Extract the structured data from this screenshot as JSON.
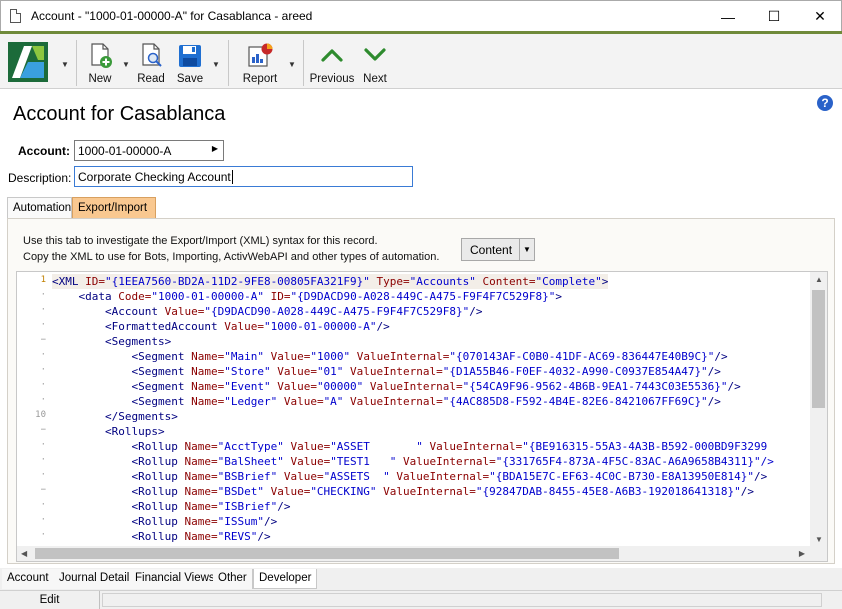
{
  "window": {
    "title": "Account - \"1000-01-00000-A\" for Casablanca - areed",
    "controls": {
      "minimize": "—",
      "maximize": "☐",
      "close": "✕"
    }
  },
  "toolbar": {
    "new_label": "New",
    "read_label": "Read",
    "save_label": "Save",
    "report_label": "Report",
    "previous_label": "Previous",
    "next_label": "Next"
  },
  "header": {
    "title": "Account for Casablanca"
  },
  "form": {
    "account_label": "Account:",
    "account_value": "1000-01-00000-A",
    "description_label": "Description:",
    "description_value": "Corporate Checking Account"
  },
  "top_tabs": [
    {
      "label": "Automation",
      "active": false
    },
    {
      "label": "Export/Import",
      "active": true
    }
  ],
  "panel": {
    "info_line1": "Use this tab to investigate the Export/Import (XML) syntax for this record.",
    "info_line2": "Copy the XML to use for Bots, Importing, ActivWebAPI and other types of automation.",
    "content_select": "Content"
  },
  "gutter": [
    "1",
    "·",
    "·",
    "·",
    "−",
    "·",
    "·",
    "·",
    "·",
    "10",
    "−",
    "·",
    "·",
    "·",
    "−",
    "·",
    "·",
    "·"
  ],
  "xml_lines": [
    [
      [
        "tag",
        "<XML "
      ],
      [
        "attr",
        "ID="
      ],
      [
        "val",
        "\"{1EEA7560-BD2A-11D2-9FE8-00805FA321F9}\""
      ],
      [
        "attr",
        " Type="
      ],
      [
        "val",
        "\"Accounts\""
      ],
      [
        "attr",
        " Content="
      ],
      [
        "val",
        "\"Complete\""
      ],
      [
        "tag",
        ">"
      ]
    ],
    [
      [
        "sp",
        "    "
      ],
      [
        "tag",
        "<data "
      ],
      [
        "attr",
        "Code="
      ],
      [
        "val",
        "\"1000-01-00000-A\""
      ],
      [
        "attr",
        " ID="
      ],
      [
        "val",
        "\"{D9DACD90-A028-449C-A475-F9F4F7C529F8}\""
      ],
      [
        "tag",
        ">"
      ]
    ],
    [
      [
        "sp",
        "        "
      ],
      [
        "tag",
        "<Account "
      ],
      [
        "attr",
        "Value="
      ],
      [
        "val",
        "\"{D9DACD90-A028-449C-A475-F9F4F7C529F8}\""
      ],
      [
        "tag",
        "/>"
      ]
    ],
    [
      [
        "sp",
        "        "
      ],
      [
        "tag",
        "<FormattedAccount "
      ],
      [
        "attr",
        "Value="
      ],
      [
        "val",
        "\"1000-01-00000-A\""
      ],
      [
        "tag",
        "/>"
      ]
    ],
    [
      [
        "sp",
        "        "
      ],
      [
        "tag",
        "<Segments>"
      ]
    ],
    [
      [
        "sp",
        "            "
      ],
      [
        "tag",
        "<Segment "
      ],
      [
        "attr",
        "Name="
      ],
      [
        "val",
        "\"Main\""
      ],
      [
        "attr",
        " Value="
      ],
      [
        "val",
        "\"1000\""
      ],
      [
        "attr",
        " ValueInternal="
      ],
      [
        "val",
        "\"{070143AF-C0B0-41DF-AC69-836447E40B9C}\""
      ],
      [
        "tag",
        "/>"
      ]
    ],
    [
      [
        "sp",
        "            "
      ],
      [
        "tag",
        "<Segment "
      ],
      [
        "attr",
        "Name="
      ],
      [
        "val",
        "\"Store\""
      ],
      [
        "attr",
        " Value="
      ],
      [
        "val",
        "\"01\""
      ],
      [
        "attr",
        " ValueInternal="
      ],
      [
        "val",
        "\"{D1A55B46-F0EF-4032-A990-C0937E854A47}\""
      ],
      [
        "tag",
        "/>"
      ]
    ],
    [
      [
        "sp",
        "            "
      ],
      [
        "tag",
        "<Segment "
      ],
      [
        "attr",
        "Name="
      ],
      [
        "val",
        "\"Event\""
      ],
      [
        "attr",
        " Value="
      ],
      [
        "val",
        "\"00000\""
      ],
      [
        "attr",
        " ValueInternal="
      ],
      [
        "val",
        "\"{54CA9F96-9562-4B6B-9EA1-7443C03E5536}\""
      ],
      [
        "tag",
        "/>"
      ]
    ],
    [
      [
        "sp",
        "            "
      ],
      [
        "tag",
        "<Segment "
      ],
      [
        "attr",
        "Name="
      ],
      [
        "val",
        "\"Ledger\""
      ],
      [
        "attr",
        " Value="
      ],
      [
        "val",
        "\"A\""
      ],
      [
        "attr",
        " ValueInternal="
      ],
      [
        "val",
        "\"{4AC885D8-F592-4B4E-82E6-8421067FF69C}\""
      ],
      [
        "tag",
        "/>"
      ]
    ],
    [
      [
        "sp",
        "        "
      ],
      [
        "tag",
        "</Segments>"
      ]
    ],
    [
      [
        "sp",
        "        "
      ],
      [
        "tag",
        "<Rollups>"
      ]
    ],
    [
      [
        "sp",
        "            "
      ],
      [
        "tag",
        "<Rollup "
      ],
      [
        "attr",
        "Name="
      ],
      [
        "val",
        "\"AcctType\""
      ],
      [
        "attr",
        " Value="
      ],
      [
        "val",
        "\"ASSET       \""
      ],
      [
        "attr",
        " ValueInternal="
      ],
      [
        "val",
        "\"{BE916315-55A3-4A3B-B592-000BD9F3299"
      ]
    ],
    [
      [
        "sp",
        "            "
      ],
      [
        "tag",
        "<Rollup "
      ],
      [
        "attr",
        "Name="
      ],
      [
        "val",
        "\"BalSheet\""
      ],
      [
        "attr",
        " Value="
      ],
      [
        "val",
        "\"TEST1   \""
      ],
      [
        "attr",
        " ValueInternal="
      ],
      [
        "val",
        "\"{331765F4-873A-4F5C-83AC-A6A9658B4311}\"/>"
      ]
    ],
    [
      [
        "sp",
        "            "
      ],
      [
        "tag",
        "<Rollup "
      ],
      [
        "attr",
        "Name="
      ],
      [
        "val",
        "\"BSBrief\""
      ],
      [
        "attr",
        " Value="
      ],
      [
        "val",
        "\"ASSETS  \""
      ],
      [
        "attr",
        " ValueInternal="
      ],
      [
        "val",
        "\"{BDA15E7C-EF63-4C0C-B730-E8A13950E814}\""
      ],
      [
        "tag",
        "/>"
      ]
    ],
    [
      [
        "sp",
        "            "
      ],
      [
        "tag",
        "<Rollup "
      ],
      [
        "attr",
        "Name="
      ],
      [
        "val",
        "\"BSDet\""
      ],
      [
        "attr",
        " Value="
      ],
      [
        "val",
        "\"CHECKING\""
      ],
      [
        "attr",
        " ValueInternal="
      ],
      [
        "val",
        "\"{92847DAB-8455-45E8-A6B3-192018641318}\""
      ],
      [
        "tag",
        "/>"
      ]
    ],
    [
      [
        "sp",
        "            "
      ],
      [
        "tag",
        "<Rollup "
      ],
      [
        "attr",
        "Name="
      ],
      [
        "val",
        "\"ISBrief\""
      ],
      [
        "tag",
        "/>"
      ]
    ],
    [
      [
        "sp",
        "            "
      ],
      [
        "tag",
        "<Rollup "
      ],
      [
        "attr",
        "Name="
      ],
      [
        "val",
        "\"ISSum\""
      ],
      [
        "tag",
        "/>"
      ]
    ],
    [
      [
        "sp",
        "            "
      ],
      [
        "tag",
        "<Rollup "
      ],
      [
        "attr",
        "Name="
      ],
      [
        "val",
        "\"REVS\""
      ],
      [
        "tag",
        "/>"
      ]
    ]
  ],
  "bottom_tabs": [
    {
      "label": "Account",
      "active": false
    },
    {
      "label": "Journal Detail",
      "active": false
    },
    {
      "label": "Financial Views",
      "active": false
    },
    {
      "label": "Other",
      "active": false
    },
    {
      "label": "Developer",
      "active": true
    }
  ],
  "status": {
    "mode": "Edit"
  },
  "colors": {
    "toolbar_accent": "#6f8a3a",
    "active_tab": "#f9c890",
    "xml_tag": "#000080",
    "xml_attr": "#8b0000",
    "xml_value": "#0000cd"
  },
  "icons": {
    "app_logo": "activant-logo-icon",
    "new": "new-document-icon",
    "read": "read-document-icon",
    "save": "floppy-disk-icon",
    "report": "report-chart-icon",
    "previous": "chevron-up-icon",
    "next": "chevron-down-icon",
    "help": "help-icon"
  }
}
